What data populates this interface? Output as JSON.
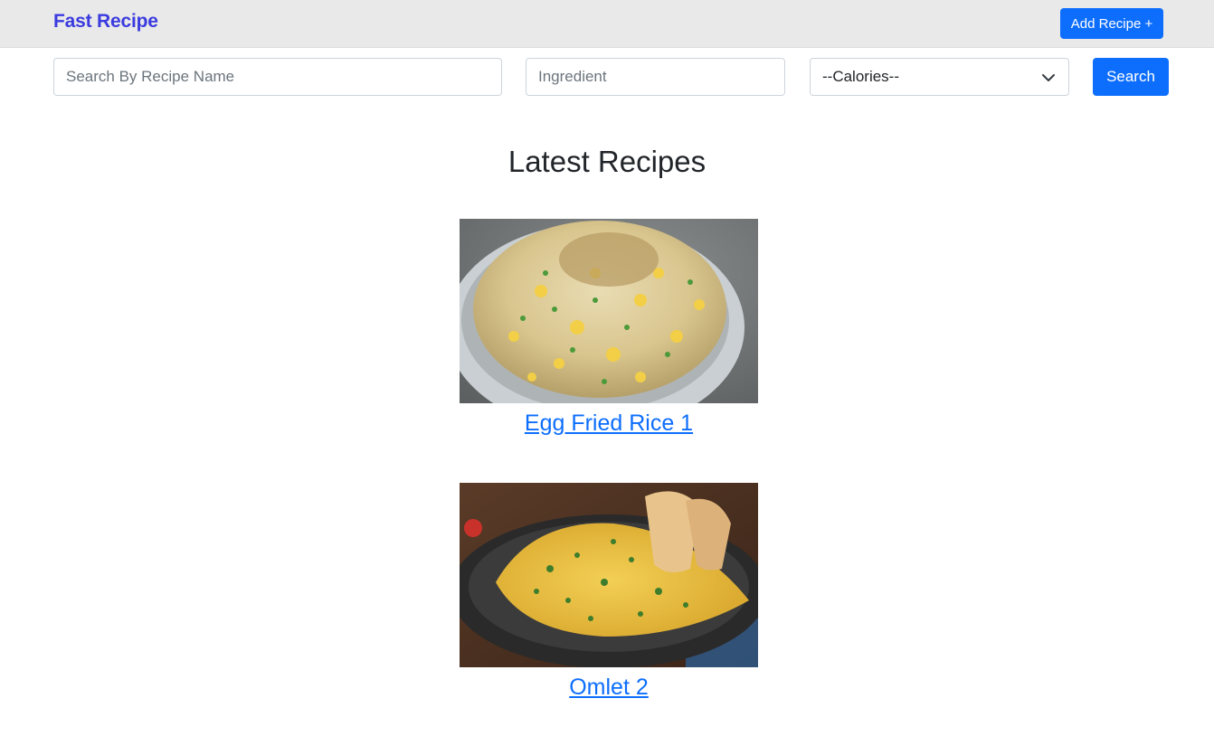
{
  "navbar": {
    "brand": "Fast Recipe",
    "add_recipe_label": "Add Recipe +"
  },
  "search": {
    "name_placeholder": "Search By Recipe Name",
    "ingredient_placeholder": "Ingredient",
    "calories_selected": "--Calories--",
    "search_label": "Search"
  },
  "main": {
    "heading": "Latest Recipes",
    "recipes": [
      {
        "title": "Egg Fried Rice 1",
        "image": "egg-fried-rice-photo"
      },
      {
        "title": "Omlet 2",
        "image": "omelette-photo"
      }
    ]
  },
  "colors": {
    "brand": "#3b3be0",
    "primary": "#0d6efd",
    "navbar_bg": "#e9e9e9"
  }
}
